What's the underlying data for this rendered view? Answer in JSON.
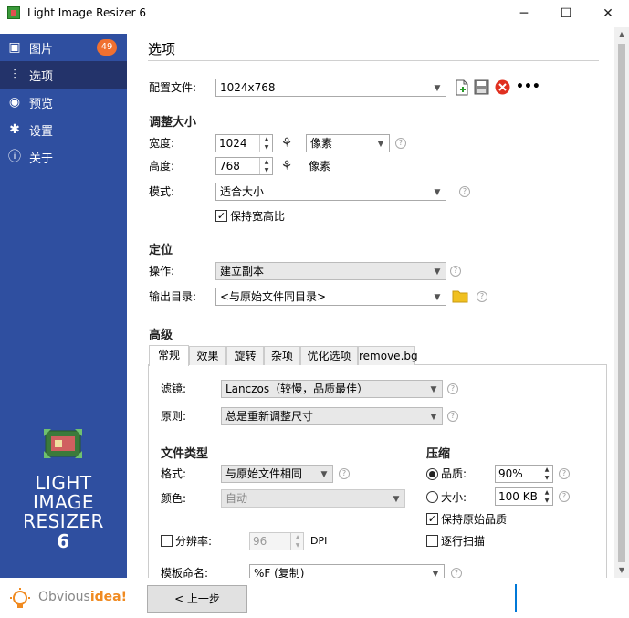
{
  "window": {
    "title": "Light Image Resizer 6",
    "minimize": "─",
    "maximize": "☐",
    "close": "✕"
  },
  "sidebar": {
    "items": [
      {
        "label": "图片",
        "icon": "images-icon",
        "glyph": "▣",
        "badge": "49"
      },
      {
        "label": "选项",
        "icon": "sliders-icon",
        "glyph": "⫶"
      },
      {
        "label": "预览",
        "icon": "eye-icon",
        "glyph": "◉"
      },
      {
        "label": "设置",
        "icon": "gear-icon",
        "glyph": "✱"
      },
      {
        "label": "关于",
        "icon": "info-icon",
        "glyph": "ⓘ"
      }
    ],
    "logo_lines": [
      "LIGHT",
      "IMAGE",
      "RESIZER",
      "6"
    ],
    "brand": {
      "prefix": "Obvious",
      "suffix": "idea!"
    }
  },
  "page": {
    "title": "选项"
  },
  "profile": {
    "label": "配置文件:",
    "value": "1024x768",
    "more": "•••"
  },
  "resize": {
    "section": "调整大小",
    "width_label": "宽度:",
    "width_value": "1024",
    "unit_value": "像素",
    "height_label": "高度:",
    "height_value": "768",
    "height_unit": "像素",
    "mode_label": "模式:",
    "mode_value": "适合大小",
    "keep_ratio_label": "保持宽高比",
    "keep_ratio_checked": true
  },
  "position": {
    "section": "定位",
    "action_label": "操作:",
    "action_value": "建立副本",
    "output_label": "输出目录:",
    "output_value": "<与原始文件同目录>"
  },
  "advanced": {
    "section": "高级",
    "tabs": [
      "常规",
      "效果",
      "旋转",
      "杂项",
      "优化选项",
      "remove.bg"
    ],
    "active_tab": "常规",
    "filter_label": "滤镜:",
    "filter_value": "Lanczos（较慢，品质最佳）",
    "rule_label": "原则:",
    "rule_value": "总是重新调整尺寸",
    "filetype_section": "文件类型",
    "format_label": "格式:",
    "format_value": "与原始文件相同",
    "color_label": "颜色:",
    "color_value": "自动",
    "resolution_label": "分辨率:",
    "resolution_value": "96",
    "resolution_unit": "DPI",
    "compress_section": "压缩",
    "quality_label": "品质:",
    "quality_value": "90%",
    "size_label": "大小:",
    "size_value": "100 KB",
    "keep_quality_label": "保持原始品质",
    "progressive_label": "逐行扫描",
    "template_label": "模板命名:",
    "template_value": "%F (复制)"
  },
  "footer": {
    "back_label": "< 上一步"
  },
  "colors": {
    "sidebar": "#2f4fa0",
    "sidebar_active": "#23336a",
    "badge": "#f07030",
    "brand_orange": "#f08a20",
    "folder": "#f0c020",
    "delete_red": "#e03020"
  }
}
